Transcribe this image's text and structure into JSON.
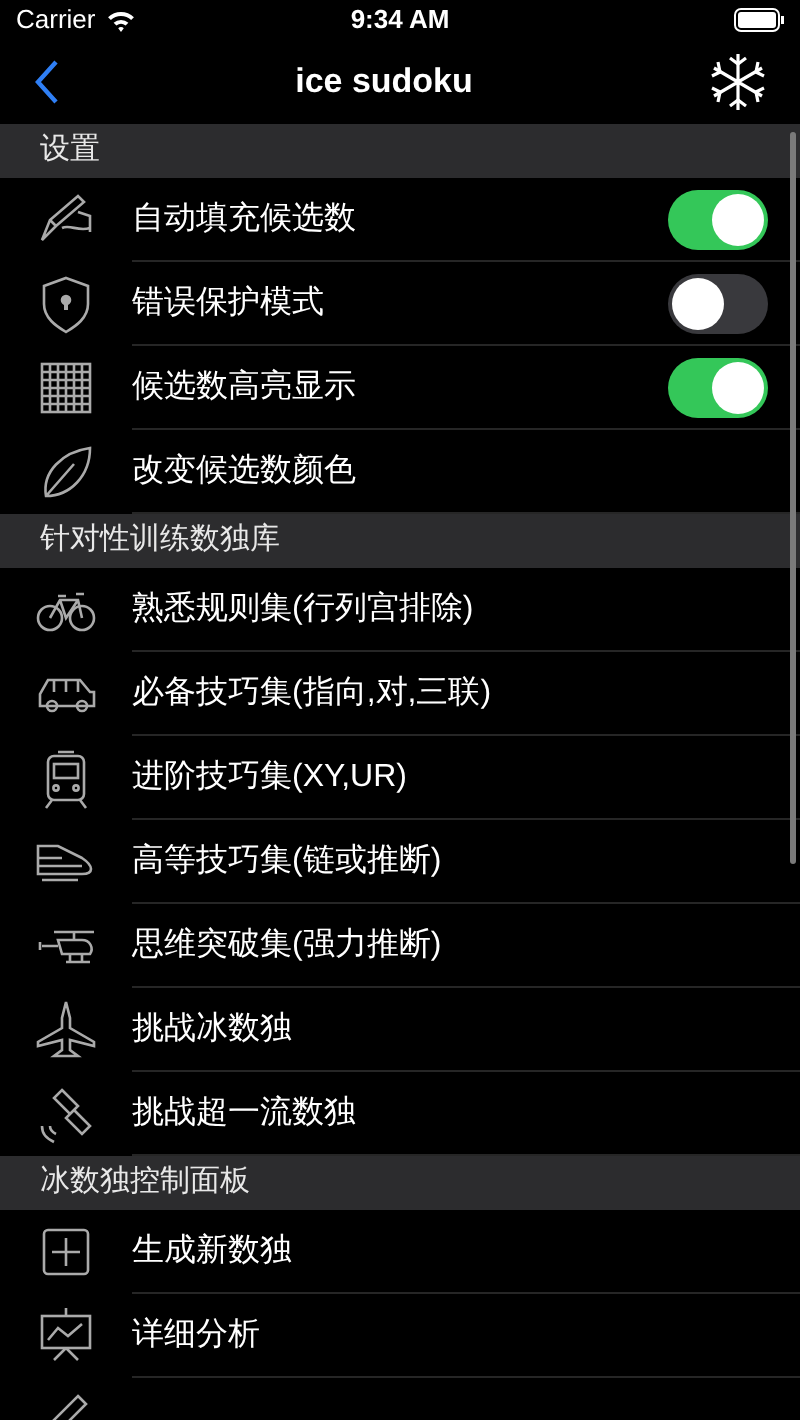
{
  "status_bar": {
    "carrier": "Carrier",
    "time": "9:34 AM"
  },
  "nav": {
    "title": "ice sudoku"
  },
  "sections": [
    {
      "title": "设置",
      "rows": [
        {
          "kind": "toggle",
          "label": "自动填充候选数",
          "on": true
        },
        {
          "kind": "toggle",
          "label": "错误保护模式",
          "on": false
        },
        {
          "kind": "toggle",
          "label": "候选数高亮显示",
          "on": true
        },
        {
          "kind": "link",
          "label": "改变候选数颜色"
        }
      ]
    },
    {
      "title": "针对性训练数独库",
      "rows": [
        {
          "kind": "link",
          "label": "熟悉规则集(行列宫排除)"
        },
        {
          "kind": "link",
          "label": "必备技巧集(指向,对,三联)"
        },
        {
          "kind": "link",
          "label": "进阶技巧集(XY,UR)"
        },
        {
          "kind": "link",
          "label": "高等技巧集(链或推断)"
        },
        {
          "kind": "link",
          "label": "思维突破集(强力推断)"
        },
        {
          "kind": "link",
          "label": "挑战冰数独"
        },
        {
          "kind": "link",
          "label": "挑战超一流数独"
        }
      ]
    },
    {
      "title": "冰数独控制面板",
      "rows": [
        {
          "kind": "link",
          "label": "生成新数独"
        },
        {
          "kind": "link",
          "label": "详细分析"
        },
        {
          "kind": "link"
        }
      ]
    }
  ]
}
